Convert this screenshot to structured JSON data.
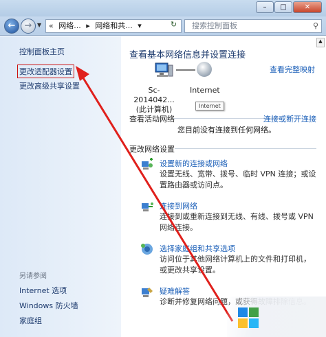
{
  "window": {
    "minimize": "–",
    "maximize": "□",
    "close": "✕"
  },
  "address": {
    "prefix": "«",
    "crumb1": "网络...",
    "sep": "▸",
    "crumb2": "网络和共...",
    "drop": "▾",
    "search_placeholder": "搜索控制面板"
  },
  "sidebar": {
    "home": "控制面板主页",
    "adapter": "更改适配器设置",
    "sharing": "更改高级共享设置",
    "see_also": "另请参阅",
    "internet_options": "Internet 选项",
    "firewall": "Windows 防火墙",
    "homegroup": "家庭组"
  },
  "main": {
    "title": "查看基本网络信息并设置连接",
    "view_full_map": "查看完整映射",
    "computer_name": "Sc-2014042...",
    "computer_sub": "(此计算机)",
    "internet_label": "Internet",
    "tooltip": "Internet",
    "active_section": "查看活动网络",
    "connect_link": "连接或断开连接",
    "active_message": "您目前没有连接到任何网络。",
    "change_section": "更改网络设置",
    "tasks": [
      {
        "title": "设置新的连接或网络",
        "desc": "设置无线、宽带、拨号、临时 VPN 连接；或设置路由器或访问点。"
      },
      {
        "title": "连接到网络",
        "desc": "连接到或重新连接到无线、有线、拨号或 VPN 网络连接。"
      },
      {
        "title": "选择家庭组和共享选项",
        "desc": "访问位于其他网络计算机上的文件和打印机，或更改共享设置。"
      },
      {
        "title": "疑难解答",
        "desc": "诊断并修复网络问题，或获得故障排除信息。"
      }
    ]
  },
  "colors": {
    "annotation": "#e0201c",
    "link": "#1b5fb8"
  }
}
